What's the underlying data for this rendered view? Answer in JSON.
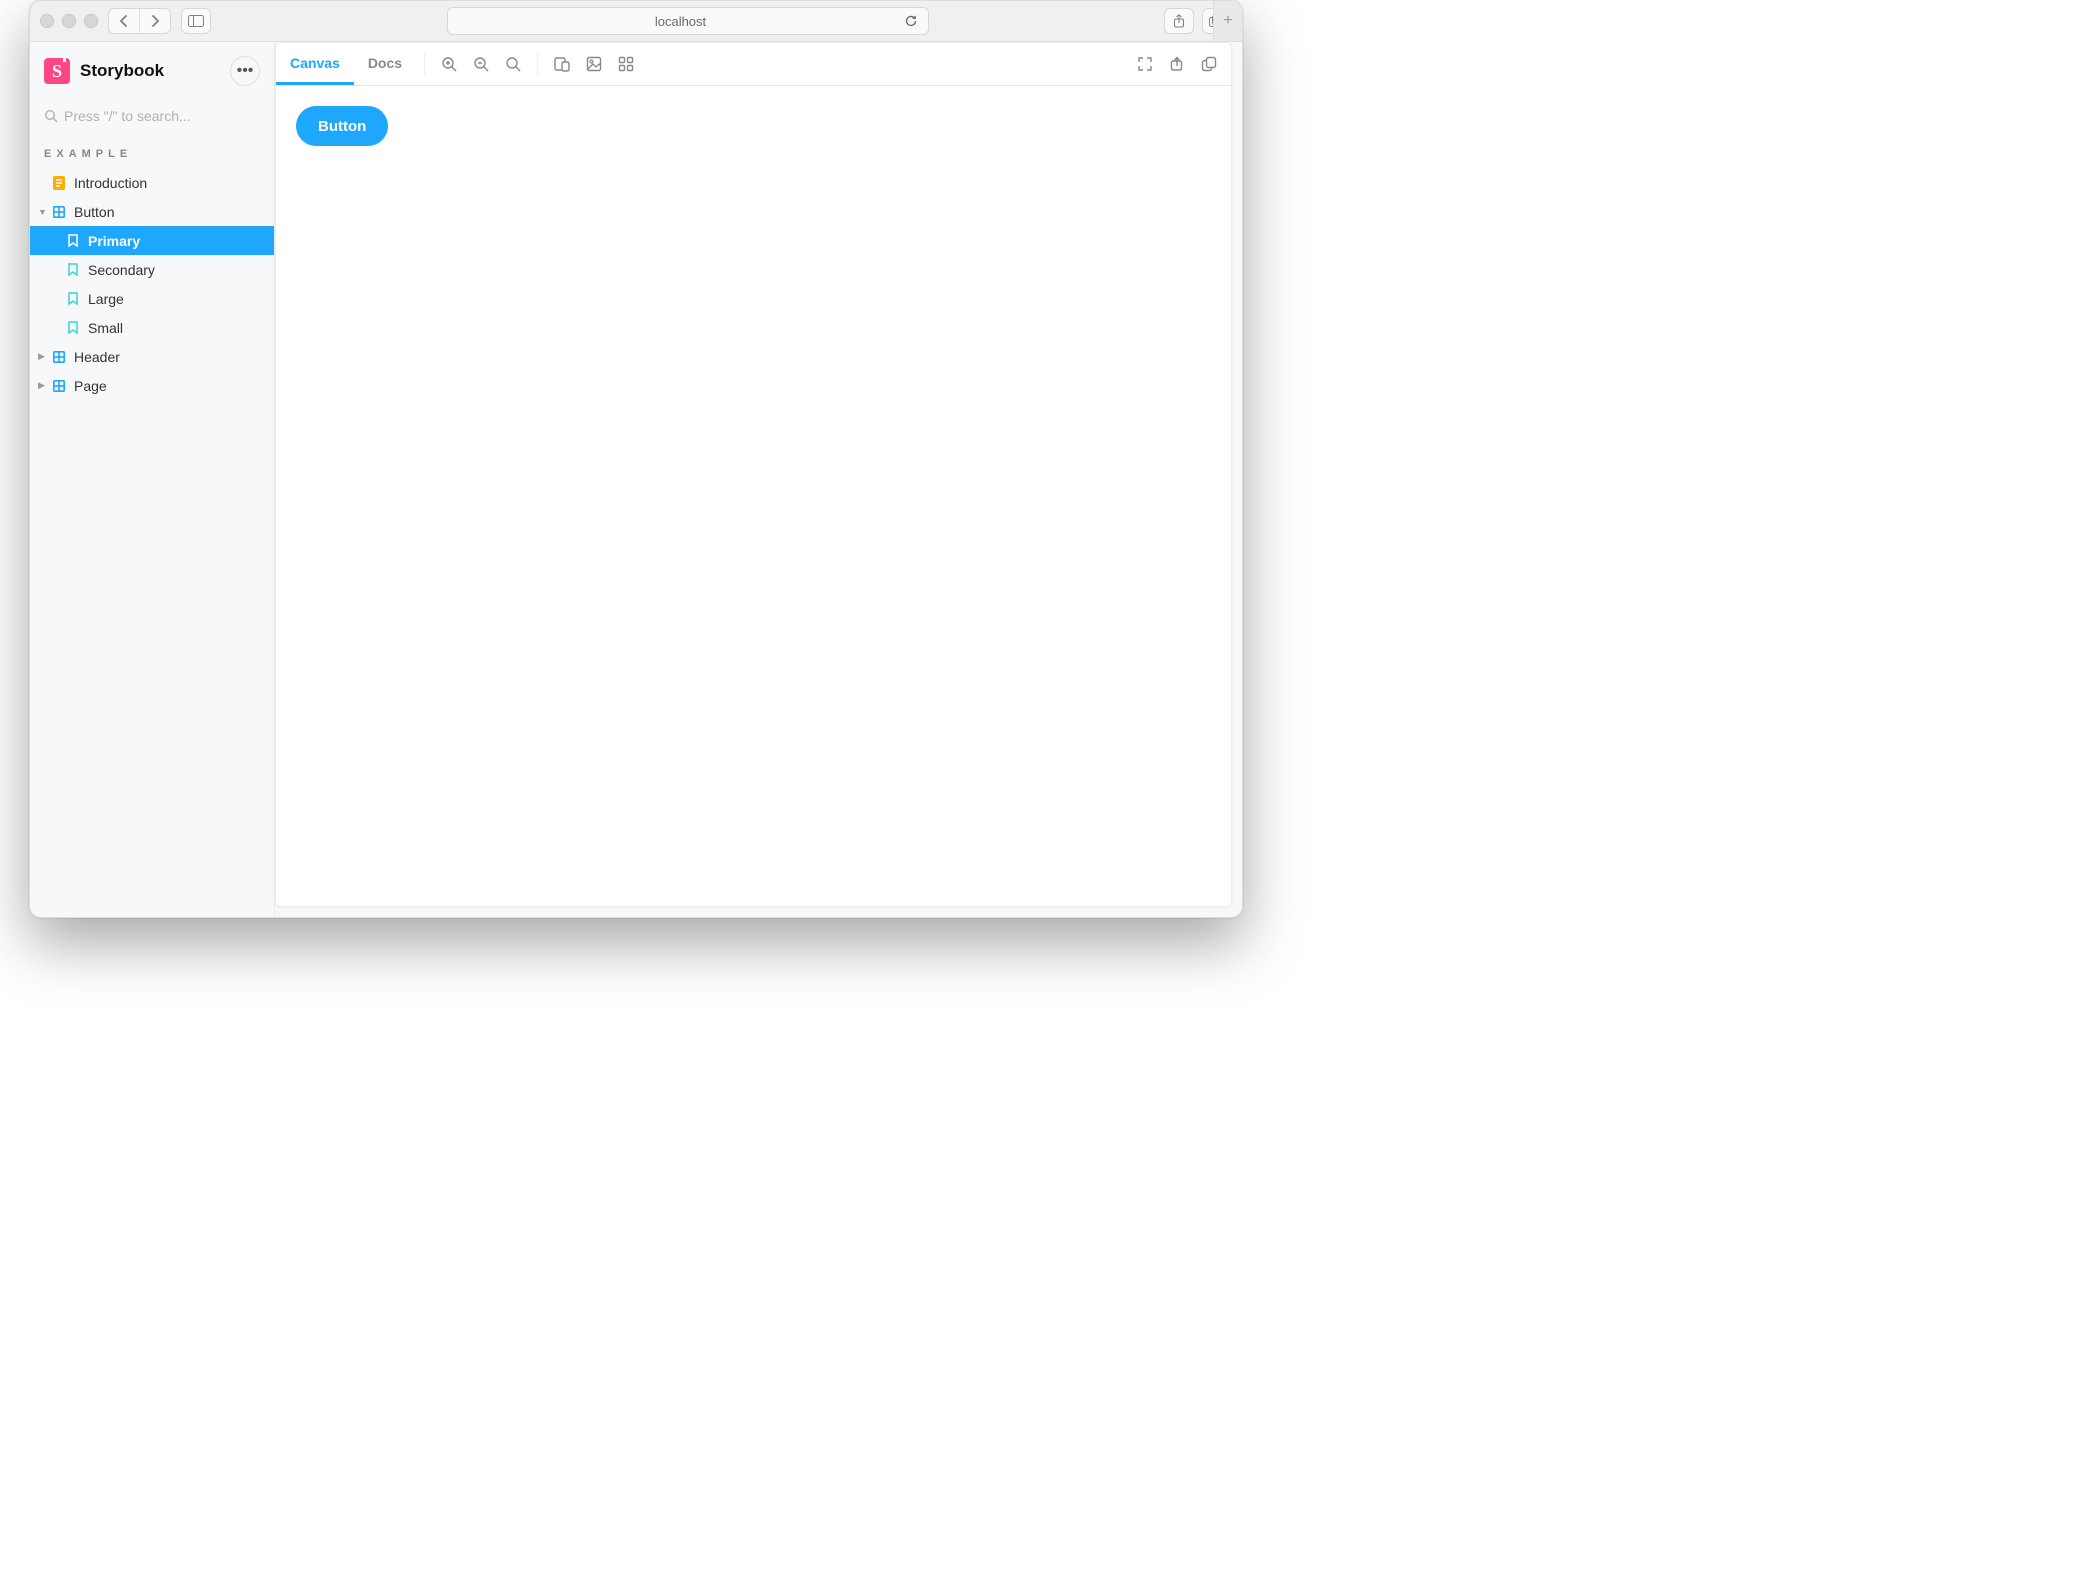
{
  "browser": {
    "url": "localhost"
  },
  "brand": {
    "title": "Storybook",
    "logo_letter": "S"
  },
  "search": {
    "placeholder": "Press \"/\" to search..."
  },
  "sidebar": {
    "section_label": "EXAMPLE",
    "items": {
      "introduction": "Introduction",
      "button": "Button",
      "header": "Header",
      "page": "Page"
    },
    "stories": {
      "primary": "Primary",
      "secondary": "Secondary",
      "large": "Large",
      "small": "Small"
    }
  },
  "tabs": {
    "canvas": "Canvas",
    "docs": "Docs"
  },
  "canvas": {
    "button_label": "Button"
  }
}
